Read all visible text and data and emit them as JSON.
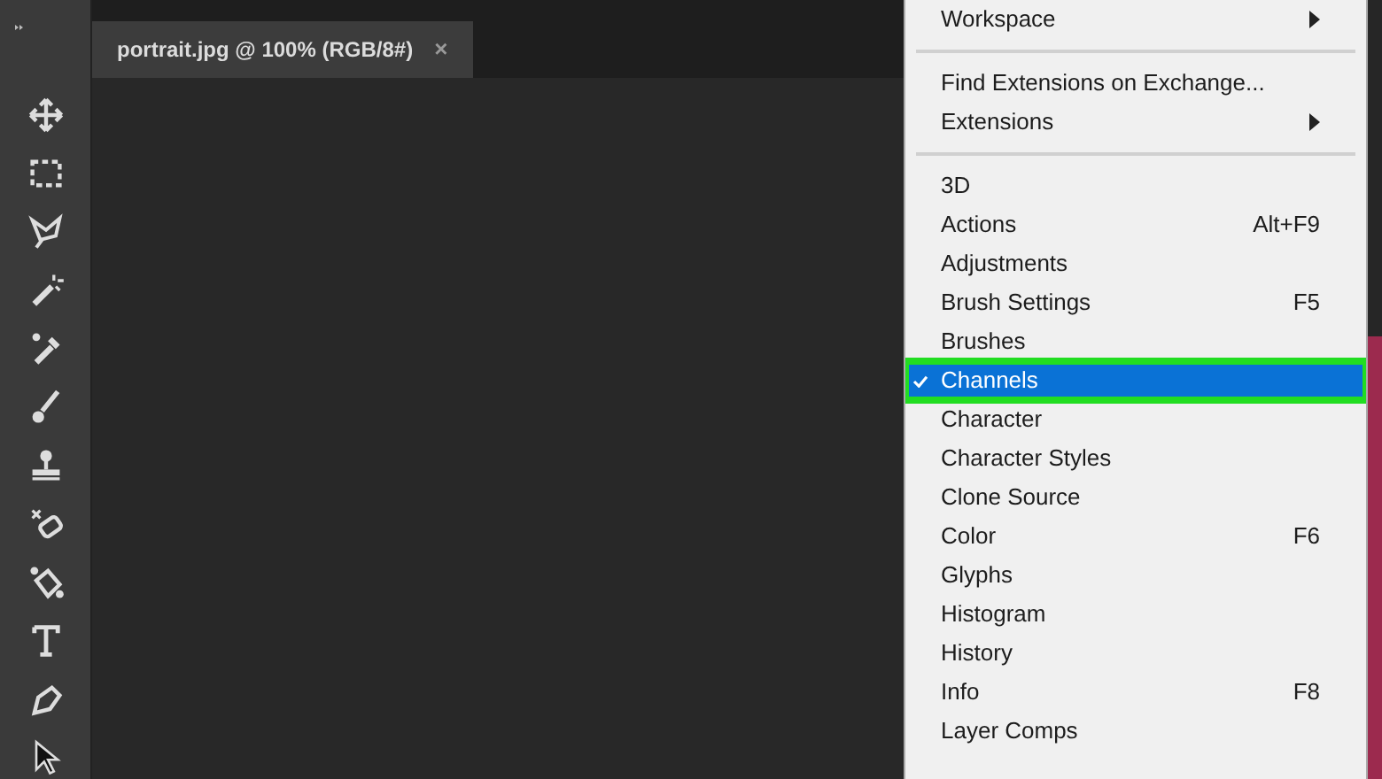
{
  "document_tab": {
    "title": "portrait.jpg @ 100% (RGB/8#)",
    "close": "×"
  },
  "tools": [
    {
      "kind": "move"
    },
    {
      "kind": "marquee"
    },
    {
      "kind": "lasso"
    },
    {
      "kind": "wand"
    },
    {
      "kind": "eyedropper"
    },
    {
      "kind": "brush"
    },
    {
      "kind": "stamp"
    },
    {
      "kind": "eraser"
    },
    {
      "kind": "bucket"
    },
    {
      "kind": "type"
    },
    {
      "kind": "pen"
    },
    {
      "kind": "select"
    }
  ],
  "menu": {
    "groups": [
      [
        {
          "label": "Workspace",
          "submenu": true,
          "checked": false,
          "selected": false
        }
      ],
      [
        {
          "label": "Find Extensions on Exchange...",
          "submenu": false,
          "checked": false,
          "selected": false
        },
        {
          "label": "Extensions",
          "submenu": true,
          "checked": false,
          "selected": false
        }
      ],
      [
        {
          "label": "3D",
          "submenu": false,
          "checked": false,
          "selected": false
        },
        {
          "label": "Actions",
          "shortcut": "Alt+F9",
          "submenu": false,
          "checked": false,
          "selected": false
        },
        {
          "label": "Adjustments",
          "submenu": false,
          "checked": false,
          "selected": false
        },
        {
          "label": "Brush Settings",
          "shortcut": "F5",
          "submenu": false,
          "checked": false,
          "selected": false
        },
        {
          "label": "Brushes",
          "submenu": false,
          "checked": false,
          "selected": false
        },
        {
          "label": "Channels",
          "submenu": false,
          "checked": true,
          "selected": true
        },
        {
          "label": "Character",
          "submenu": false,
          "checked": false,
          "selected": false
        },
        {
          "label": "Character Styles",
          "submenu": false,
          "checked": false,
          "selected": false
        },
        {
          "label": "Clone Source",
          "submenu": false,
          "checked": false,
          "selected": false
        },
        {
          "label": "Color",
          "shortcut": "F6",
          "submenu": false,
          "checked": false,
          "selected": false
        },
        {
          "label": "Glyphs",
          "submenu": false,
          "checked": false,
          "selected": false
        },
        {
          "label": "Histogram",
          "submenu": false,
          "checked": false,
          "selected": false
        },
        {
          "label": "History",
          "submenu": false,
          "checked": false,
          "selected": false
        },
        {
          "label": "Info",
          "shortcut": "F8",
          "submenu": false,
          "checked": false,
          "selected": false
        },
        {
          "label": "Layer Comps",
          "submenu": false,
          "checked": false,
          "selected": false
        }
      ]
    ]
  }
}
